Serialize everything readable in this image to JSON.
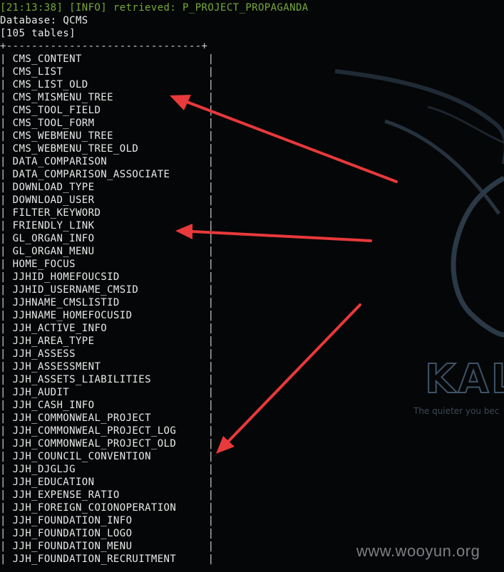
{
  "terminal": {
    "log_line": "[21:13:38] [INFO] retrieved: P_PROJECT_PROPAGANDA",
    "database_label": "Database:",
    "database_name": "QCMS",
    "table_count": "[105 tables]",
    "border": "+-------------------------------+"
  },
  "tables": [
    "CMS_CONTENT",
    "CMS_LIST",
    "CMS_LIST_OLD",
    "CMS_MISMENU_TREE",
    "CMS_TOOL_FIELD",
    "CMS_TOOL_FORM",
    "CMS_WEBMENU_TREE",
    "CMS_WEBMENU_TREE_OLD",
    "DATA_COMPARISON",
    "DATA_COMPARISON_ASSOCIATE",
    "DOWNLOAD_TYPE",
    "DOWNLOAD_USER",
    "FILTER_KEYWORD",
    "FRIENDLY_LINK",
    "GL_ORGAN_INFO",
    "GL_ORGAN_MENU",
    "HOME_FOCUS",
    "JJHID_HOMEFOUCSID",
    "JJHID_USERNAME_CMSID",
    "JJHNAME_CMSLISTID",
    "JJHNAME_HOMEFOCUSID",
    "JJH_ACTIVE_INFO",
    "JJH_AREA_TYPE",
    "JJH_ASSESS",
    "JJH_ASSESSMENT",
    "JJH_ASSETS_LIABILITIES",
    "JJH_AUDIT",
    "JJH_CASH_INFO",
    "JJH_COMMONWEAL_PROJECT",
    "JJH_COMMONWEAL_PROJECT_LOG",
    "JJH_COMMONWEAL_PROJECT_OLD",
    "JJH_COUNCIL_CONVENTION",
    "JJH_DJGLJG",
    "JJH_EDUCATION",
    "JJH_EXPENSE_RATIO",
    "JJH_FOREIGN_COIONOPERATION",
    "JJH_FOUNDATION_INFO",
    "JJH_FOUNDATION_LOGO",
    "JJH_FOUNDATION_MENU",
    "JJH_FOUNDATION_RECRUITMENT"
  ],
  "wallpaper": {
    "logo_text": "KALI",
    "tagline": "The quieter you bec",
    "watermark": "www.wooyun.org"
  },
  "colors": {
    "background": "#050607",
    "terminal_text": "#e9e9e9",
    "log_text": "#77a83d",
    "arrow": "#e8393b",
    "dragon": "#26323e"
  }
}
